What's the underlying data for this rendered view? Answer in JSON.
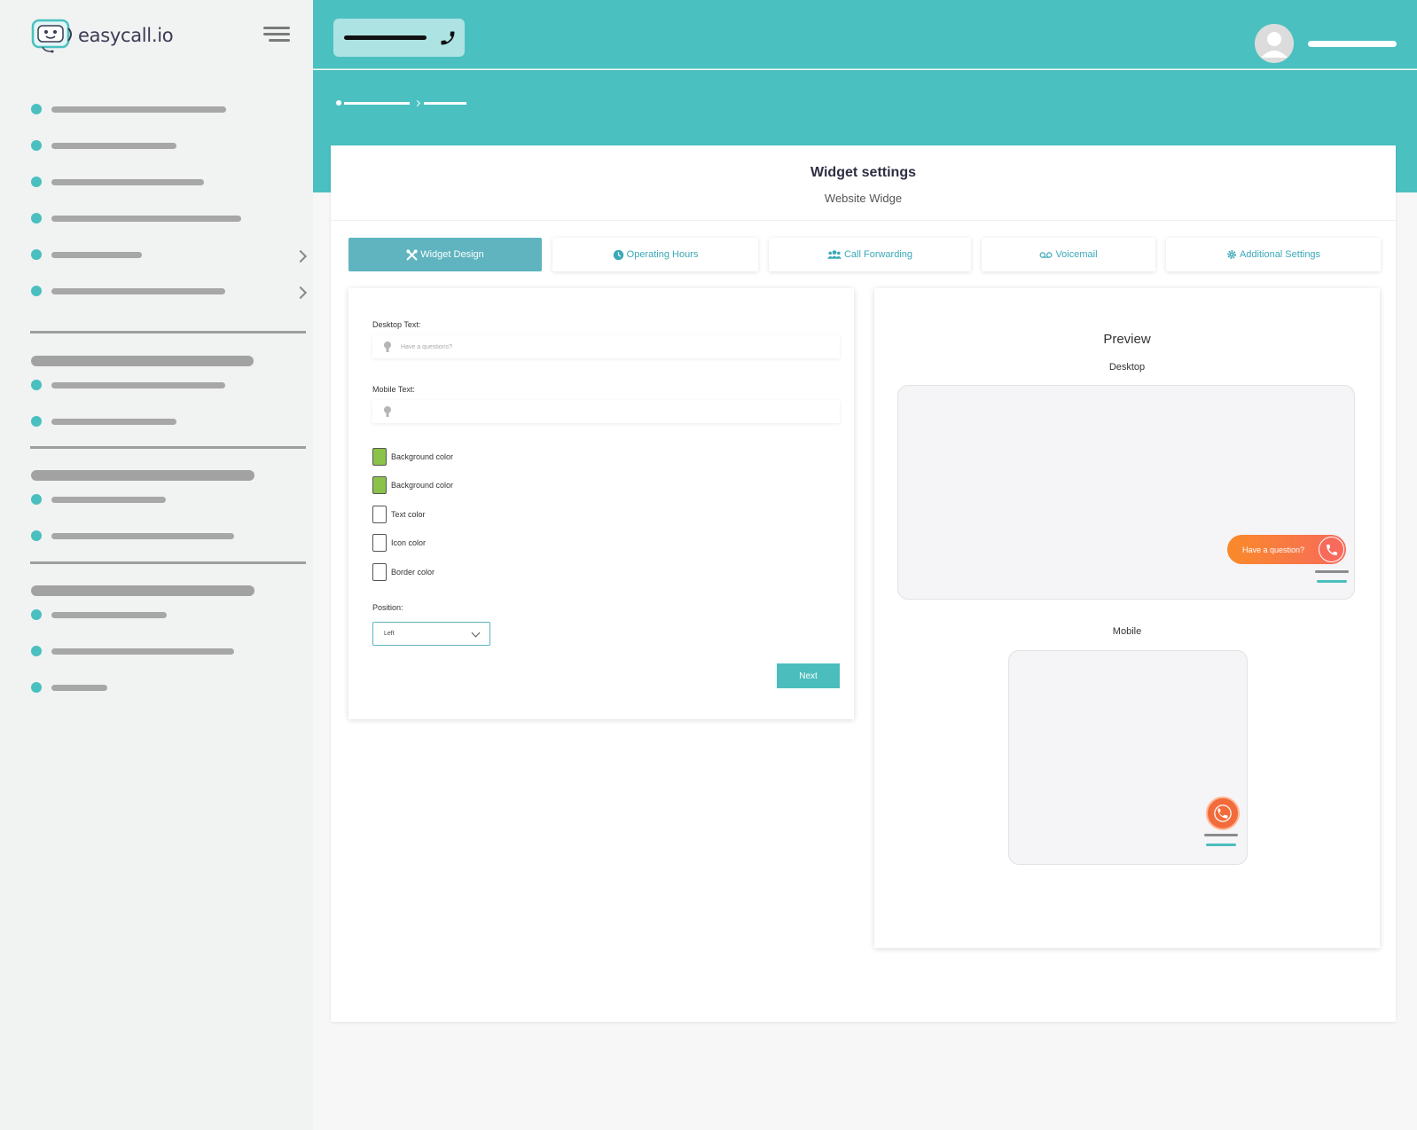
{
  "app": {
    "brand": "easycall.io"
  },
  "page": {
    "title": "Widget settings",
    "subtitle": "Website Widge"
  },
  "tabs": [
    {
      "label": "Widget Design",
      "icon": "tools-icon",
      "active": true
    },
    {
      "label": "Operating Hours",
      "icon": "clock-icon",
      "active": false
    },
    {
      "label": "Call Forwarding",
      "icon": "users-icon",
      "active": false
    },
    {
      "label": "Voicemail",
      "icon": "voicemail-icon",
      "active": false
    },
    {
      "label": "Additional Settings",
      "icon": "gear-icon",
      "active": false
    }
  ],
  "form": {
    "desktop_text_label": "Desktop Text:",
    "desktop_text_placeholder": "Have a questions?",
    "desktop_text_value": "",
    "mobile_text_label": "Mobile Text:",
    "mobile_text_placeholder": "",
    "mobile_text_value": "",
    "colors": [
      {
        "label": "Background color",
        "value": "#8bc34a"
      },
      {
        "label": "Background color",
        "value": "#8bc34a"
      },
      {
        "label": "Text color",
        "value": "#ffffff"
      },
      {
        "label": "Icon color",
        "value": "#ffffff"
      },
      {
        "label": "Border color",
        "value": "#ffffff"
      }
    ],
    "position_label": "Position:",
    "position_value": "Left",
    "next_label": "Next"
  },
  "preview": {
    "title": "Preview",
    "desktop_label": "Desktop",
    "mobile_label": "Mobile",
    "cta_text": "Have a question?"
  },
  "theme": {
    "accent": "#4bc0c0",
    "cta_gradient_start": "#f98a2a",
    "cta_gradient_end": "#f86a5b"
  }
}
